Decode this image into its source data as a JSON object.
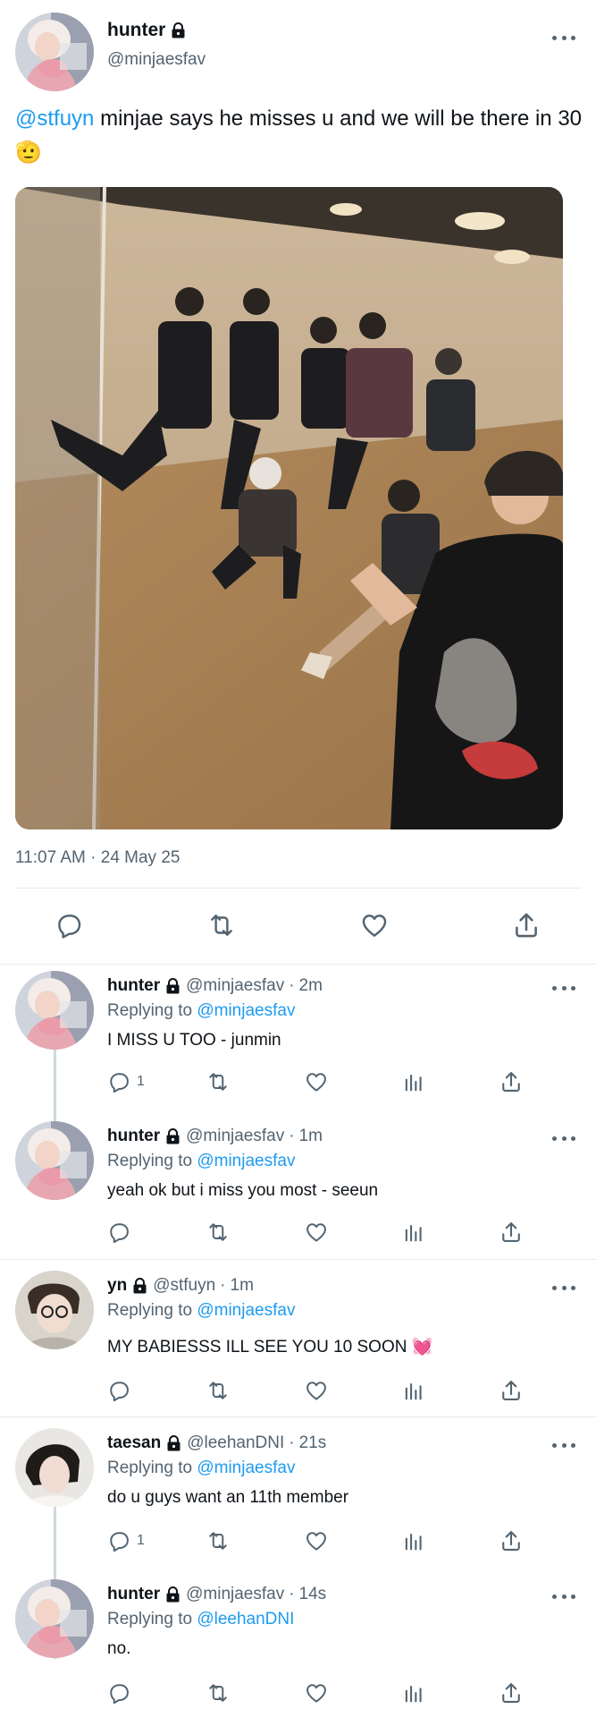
{
  "main_tweet": {
    "display_name": "hunter",
    "handle": "@minjaesfav",
    "mention": "@stfuyn",
    "text": " minjae says he misses u and we will be there in 30 🫡",
    "timestamp": "11:07 AM · 24 May 25"
  },
  "replies": [
    {
      "display_name": "hunter",
      "handle": "@minjaesfav",
      "time": "2m",
      "replying_prefix": "Replying to ",
      "replying_to": "@minjaesfav",
      "text": "I MISS U TOO - junmin",
      "reply_count": "1"
    },
    {
      "display_name": "hunter",
      "handle": "@minjaesfav",
      "time": "1m",
      "replying_prefix": "Replying to ",
      "replying_to": "@minjaesfav",
      "text": "yeah ok but i miss you most - seeun",
      "reply_count": ""
    },
    {
      "display_name": "yn",
      "handle": "@stfuyn",
      "time": "1m",
      "replying_prefix": "Replying to ",
      "replying_to": "@minjaesfav",
      "text": "MY BABIESSS ILL SEE YOU 10 SOON 💓",
      "reply_count": ""
    },
    {
      "display_name": "taesan",
      "handle": "@leehanDNI",
      "time": "21s",
      "replying_prefix": "Replying to ",
      "replying_to": "@minjaesfav",
      "text": "do u guys want an 11th member",
      "reply_count": "1"
    },
    {
      "display_name": "hunter",
      "handle": "@minjaesfav",
      "time": "14s",
      "replying_prefix": "Replying to ",
      "replying_to": "@leehanDNI",
      "text": "no.",
      "reply_count": ""
    }
  ],
  "separator": "·",
  "colors": {
    "link": "#1d9bf0",
    "secondary_text": "#536471",
    "primary_text": "#0f1419",
    "divider": "#e7e9ea"
  },
  "icons": [
    "lock-icon",
    "more-icon",
    "reply-icon",
    "retweet-icon",
    "like-icon",
    "views-icon",
    "share-icon"
  ]
}
